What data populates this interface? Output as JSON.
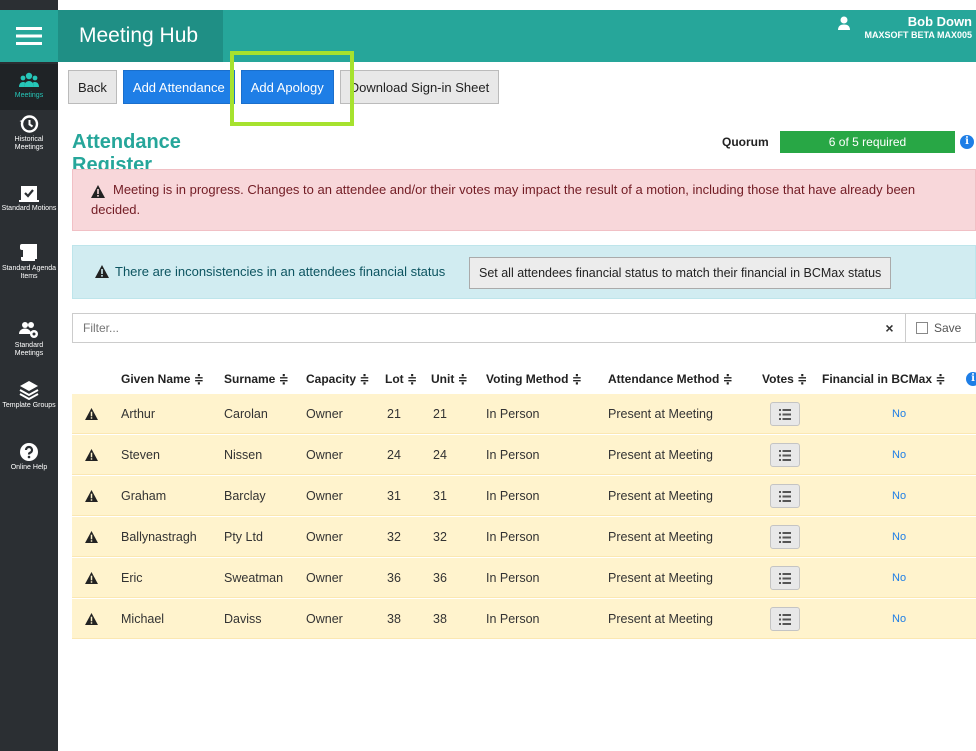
{
  "app": {
    "title": "Meeting Hub",
    "user_name": "Bob Down",
    "user_sub": "MAXSOFT BETA MAX005"
  },
  "sidebar": {
    "items": [
      {
        "label": "Meetings",
        "icon": "users-icon",
        "active": true
      },
      {
        "label": "Historical Meetings",
        "icon": "history-icon"
      },
      {
        "label": "Standard Motions",
        "icon": "checkbox-icon"
      },
      {
        "label": "Standard Agenda Items",
        "icon": "scroll-icon"
      },
      {
        "label": "Standard Meetings",
        "icon": "users-gear-icon"
      },
      {
        "label": "Template Groups",
        "icon": "layers-icon"
      },
      {
        "label": "Online Help",
        "icon": "question-icon"
      }
    ]
  },
  "toolbar": {
    "back": "Back",
    "add_attendance": "Add Attendance",
    "add_apology": "Add Apology",
    "download_sheet": "Download Sign-in Sheet"
  },
  "page": {
    "title": "Attendance Register",
    "quorum_label": "Quorum",
    "quorum_text": "6 of 5 required",
    "quorum_fraction": 1.0
  },
  "alerts": {
    "progress_line1": "Meeting is in progress. Changes to an attendee and/or their votes may impact the result of a motion, including those that have already been",
    "progress_line2": "decided.",
    "inconsistency": "There are inconsistencies in an attendees financial status",
    "sync_button": "Set all attendees financial status to match their financial in BCMax status"
  },
  "filter": {
    "placeholder": "Filter...",
    "clear": "×",
    "save": "Save"
  },
  "table": {
    "headers": {
      "given": "Given Name ≑",
      "surname": "Surname ≑",
      "capacity": "Capacity ≑",
      "lot": "Lot ≑",
      "unit": "Unit ≑",
      "voting": "Voting Method ≑",
      "attendance": "Attendance Method ≑",
      "votes": "Votes ≑",
      "financial": "Financial in BCMax ≑"
    },
    "rows": [
      {
        "given": "Arthur",
        "surname": "Carolan",
        "capacity": "Owner",
        "lot": "21",
        "unit": "21",
        "voting": "In Person",
        "attendance": "Present at Meeting",
        "financial": "No"
      },
      {
        "given": "Steven",
        "surname": "Nissen",
        "capacity": "Owner",
        "lot": "24",
        "unit": "24",
        "voting": "In Person",
        "attendance": "Present at Meeting",
        "financial": "No"
      },
      {
        "given": "Graham",
        "surname": "Barclay",
        "capacity": "Owner",
        "lot": "31",
        "unit": "31",
        "voting": "In Person",
        "attendance": "Present at Meeting",
        "financial": "No"
      },
      {
        "given": "Ballynastragh",
        "surname": "Pty Ltd",
        "capacity": "Owner",
        "lot": "32",
        "unit": "32",
        "voting": "In Person",
        "attendance": "Present at Meeting",
        "financial": "No"
      },
      {
        "given": "Eric",
        "surname": "Sweatman",
        "capacity": "Owner",
        "lot": "36",
        "unit": "36",
        "voting": "In Person",
        "attendance": "Present at Meeting",
        "financial": "No"
      },
      {
        "given": "Michael",
        "surname": "Daviss",
        "capacity": "Owner",
        "lot": "38",
        "unit": "38",
        "voting": "In Person",
        "attendance": "Present at Meeting",
        "financial": "No"
      }
    ]
  },
  "colors": {
    "teal": "#26a69a",
    "primary": "#1e7ee6",
    "highlight": "#a6e22e",
    "quorum_green": "#28a745"
  }
}
